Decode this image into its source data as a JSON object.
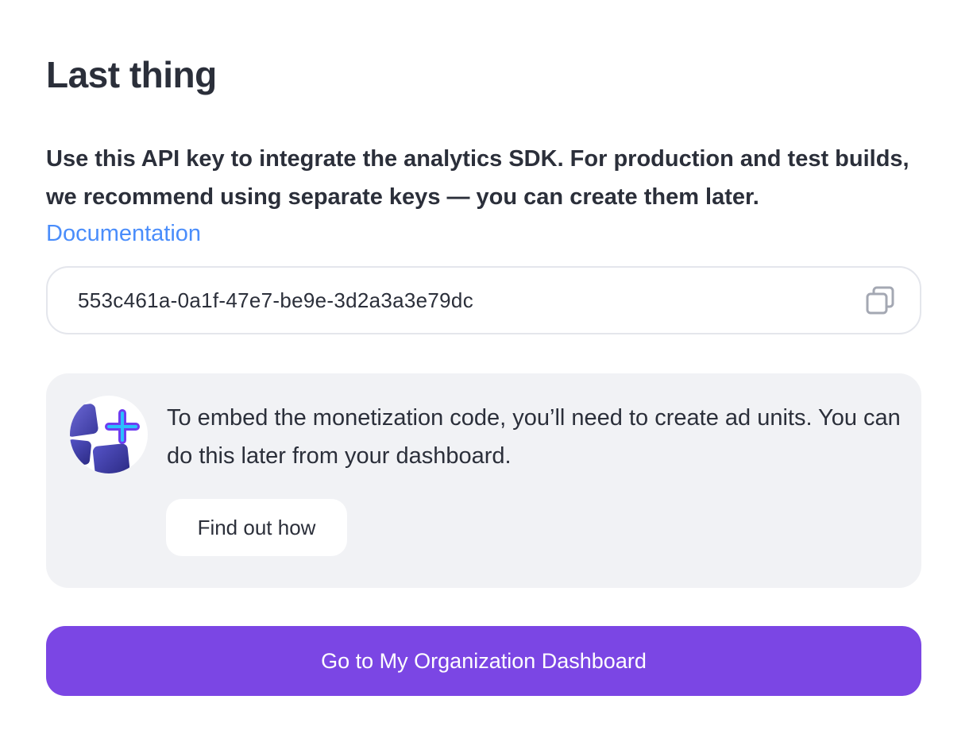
{
  "header": {
    "title": "Last thing"
  },
  "intro": {
    "description": "Use this API key to integrate the analytics SDK. For production and test builds, we recommend using separate keys — you can create them later.",
    "documentation_link": "Documentation"
  },
  "api_key": {
    "value": "553c461a-0a1f-47e7-be9e-3d2a3a3e79dc",
    "copy_icon": "copy-icon"
  },
  "info_card": {
    "icon": "ad-units-icon",
    "text": "To embed the monetization code, you’ll need to create ad units. You can do this later from your dashboard.",
    "find_out_label": "Find out how"
  },
  "footer": {
    "primary_button_label": "Go to My Organization Dashboard"
  },
  "colors": {
    "accent": "#7b46e4",
    "link": "#4a8dfb",
    "card_bg": "#f1f2f5"
  }
}
